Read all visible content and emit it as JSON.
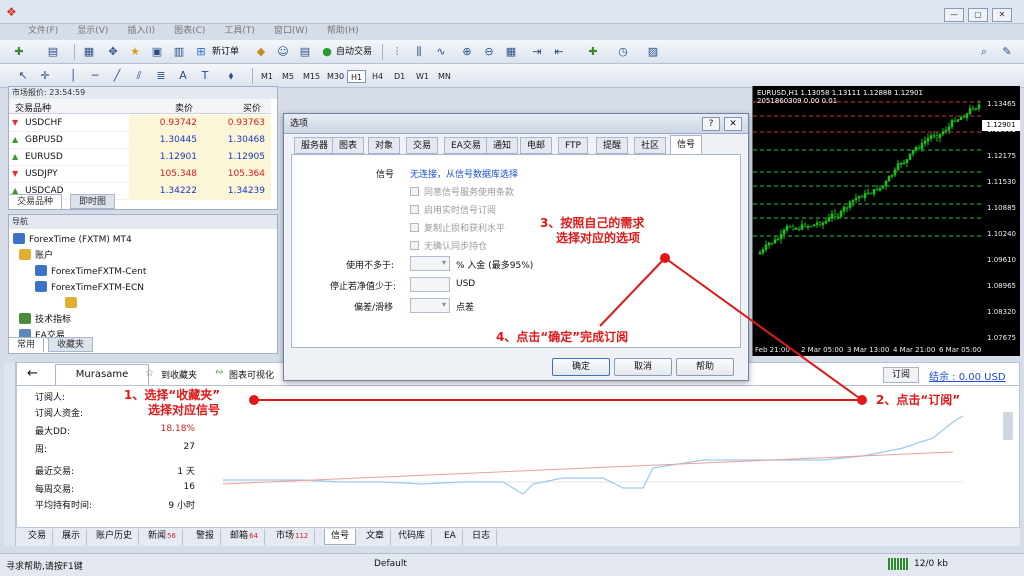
{
  "window": {
    "menu": [
      "文件(F)",
      "显示(V)",
      "插入(I)",
      "图表(C)",
      "工具(T)",
      "窗口(W)",
      "帮助(H)"
    ],
    "controls": [
      "—",
      "▢",
      "✕"
    ]
  },
  "toolbar": {
    "new_order": "新订单",
    "auto_trading": "自动交易",
    "text_tool": "A",
    "timeframes": [
      "M1",
      "M5",
      "M15",
      "M30",
      "H1",
      "H4",
      "D1",
      "W1",
      "MN"
    ],
    "active_timeframe": "H1"
  },
  "market_watch": {
    "title": "市场报价: 23:54:59",
    "col_symbol": "交易品种",
    "col_bid": "卖价",
    "col_ask": "买价",
    "rows": [
      {
        "symbol": "USDCHF",
        "bid": "0.93742",
        "ask": "0.93763",
        "dir": "down"
      },
      {
        "symbol": "GBPUSD",
        "bid": "1.30445",
        "ask": "1.30468",
        "dir": "up"
      },
      {
        "symbol": "EURUSD",
        "bid": "1.12901",
        "ask": "1.12905",
        "dir": "up"
      },
      {
        "symbol": "USDJPY",
        "bid": "105.348",
        "ask": "105.364",
        "dir": "down"
      },
      {
        "symbol": "USDCAD",
        "bid": "1.34222",
        "ask": "1.34239",
        "dir": "up"
      }
    ],
    "tabs": [
      "交易品种",
      "即时图"
    ]
  },
  "navigator": {
    "title": "导航",
    "root": "ForexTime (FXTM) MT4",
    "accounts": "账户",
    "account_1": "ForexTimeFXTM-Cent",
    "account_2": "ForexTimeFXTM-ECN",
    "indicators": "技术指标",
    "experts": "EA交易",
    "tabs": [
      "常用",
      "收藏夹"
    ]
  },
  "chart": {
    "info": "EURUSD,H1 1.13058 1.13111 1.12888 1.12901",
    "info2": "2051860309 0.00 0.01",
    "current_price": "1.12901",
    "y_ticks": [
      "1.13465",
      "1.12901",
      "1.12175",
      "1.11530",
      "1.10885",
      "1.10240",
      "1.09610",
      "1.08965",
      "1.08320",
      "1.07675"
    ],
    "x_ticks": [
      "Feb 21:00",
      "2 Mar 05:00",
      "3 Mar 13:00",
      "4 Mar 21:00",
      "6 Mar 05:00"
    ]
  },
  "dialog": {
    "title": "选项",
    "help_btn": "?",
    "close_btn": "✕",
    "tabs": [
      "服务器",
      "图表",
      "对象",
      "交易",
      "EA交易",
      "通知",
      "电邮",
      "FTP",
      "提醒",
      "社区",
      "信号"
    ],
    "active_tab": "信号",
    "signal_label": "信号",
    "signal_value": "无连接，从信号数据库选择",
    "checkboxes": [
      "同意信号服务使用条款",
      "启用实时信号订阅",
      "复制止损和获利水平",
      "无确认同步持仓"
    ],
    "use_no_more_label": "使用不多于:",
    "use_no_more_suffix": "% 入金 (最多95%)",
    "stop_if_label": "停止若净值少于:",
    "stop_if_suffix": "USD",
    "deviation_label": "偏差/滑移",
    "deviation_suffix": "点差",
    "ok": "确定",
    "cancel": "取消",
    "help": "帮助"
  },
  "signal_panel": {
    "name": "Murasame",
    "favorites": "到收藏夹",
    "visualize": "图表可视化",
    "subscribe": "订阅",
    "settlement": "结余 : 0.00 USD",
    "stats": [
      {
        "label": "订阅人:",
        "value": ""
      },
      {
        "label": "订阅人资金:",
        "value": ""
      },
      {
        "label": "最大DD:",
        "value": "18.18%"
      },
      {
        "label": "周:",
        "value": "27"
      },
      {
        "label": "最近交易:",
        "value": "1 天"
      },
      {
        "label": "每周交易:",
        "value": "16"
      },
      {
        "label": "平均持有时间:",
        "value": "9 小时"
      }
    ]
  },
  "terminal_tabs": [
    {
      "label": "交易",
      "badge": ""
    },
    {
      "label": "展示",
      "badge": ""
    },
    {
      "label": "账户历史",
      "badge": ""
    },
    {
      "label": "新闻",
      "badge": "56"
    },
    {
      "label": "警报",
      "badge": ""
    },
    {
      "label": "邮箱",
      "badge": "64"
    },
    {
      "label": "市场",
      "badge": "112"
    },
    {
      "label": "信号",
      "badge": ""
    },
    {
      "label": "文章",
      "badge": ""
    },
    {
      "label": "代码库",
      "badge": ""
    },
    {
      "label": "EA",
      "badge": ""
    },
    {
      "label": "日志",
      "badge": ""
    }
  ],
  "status": {
    "help": "寻求帮助,请按F1键",
    "profile": "Default",
    "traffic": "12/0 kb"
  },
  "annotations": {
    "a1_line1": "1、选择“收藏夹”",
    "a1_line2": "选择对应信号",
    "a2": "2、点击“订阅”",
    "a3_line1": "3、按照自己的需求",
    "a3_line2": "选择对应的选项",
    "a4": "4、点击“确定”完成订阅"
  },
  "colors": {
    "annotation": "#e01818",
    "bull_candle": "#19c419",
    "bid_up": "#1a37c8",
    "bid_down": "#d52020"
  }
}
